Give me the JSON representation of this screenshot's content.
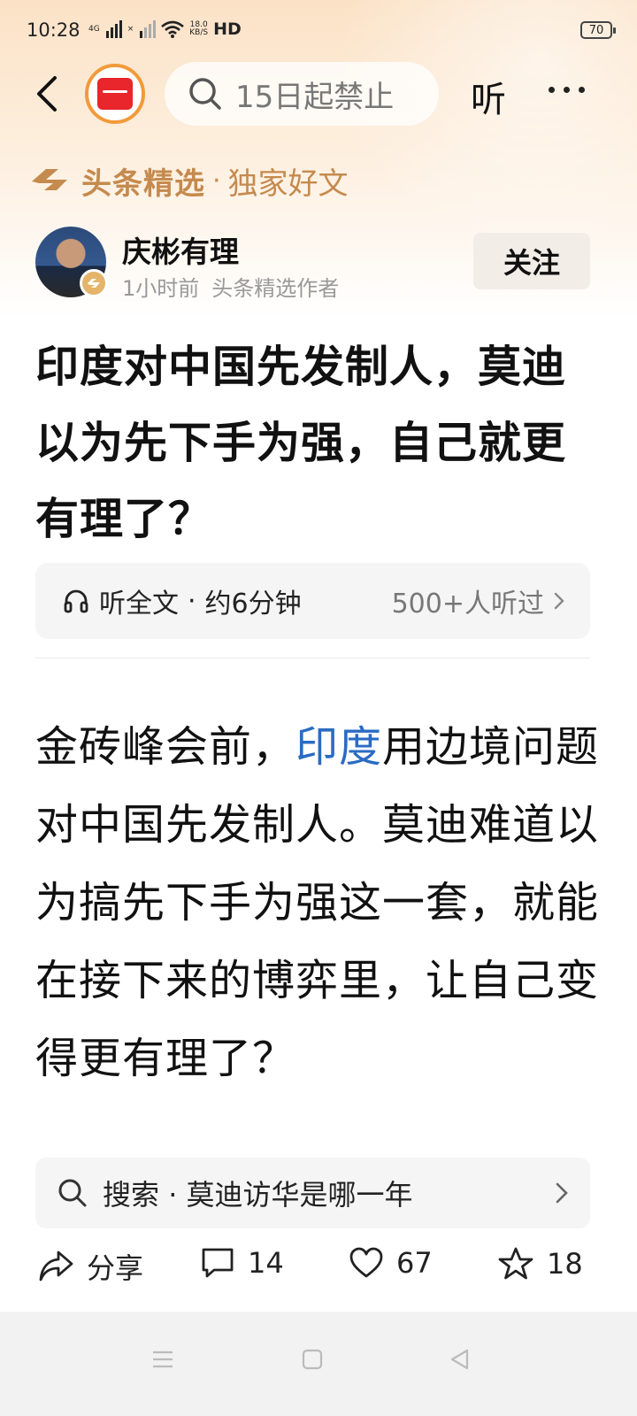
{
  "status_bar": {
    "time": "10:28",
    "network_1": "4G",
    "network_2": "×",
    "speed_value": "18.0",
    "speed_unit": "KB/S",
    "hd_label": "HD",
    "battery": "70"
  },
  "nav": {
    "search_placeholder": "15日起禁止",
    "listen_label": "听"
  },
  "brand": {
    "name": "头条精选",
    "separator": "·",
    "subtitle": "独家好文"
  },
  "author": {
    "name": "庆彬有理",
    "time": "1小时前",
    "tag": "头条精选作者",
    "follow_label": "关注"
  },
  "article": {
    "title": "印度对中国先发制人，莫迪以为先下手为强，自己就更有理了？",
    "listen_full": "听全文",
    "listen_sep": "·",
    "listen_duration": "约6分钟",
    "listeners": "500+人听过",
    "body_before_link": "金砖峰会前，",
    "body_link": "印度",
    "body_after_link": "用边境问题对中国先发制人。莫迪难道以为搞先下手为强这一套，就能在接下来的博弈里，让自己变得更有理了？"
  },
  "related_search": {
    "prefix": "搜索",
    "separator": "·",
    "query": "莫迪访华是哪一年"
  },
  "actions": {
    "share_label": "分享",
    "comments": "14",
    "likes": "67",
    "favorites": "18"
  },
  "colors": {
    "brand_gold": "#c58a4e",
    "link_blue": "#2a6bc4",
    "logo_red": "#e8262b",
    "logo_ring": "#f29a3a"
  }
}
